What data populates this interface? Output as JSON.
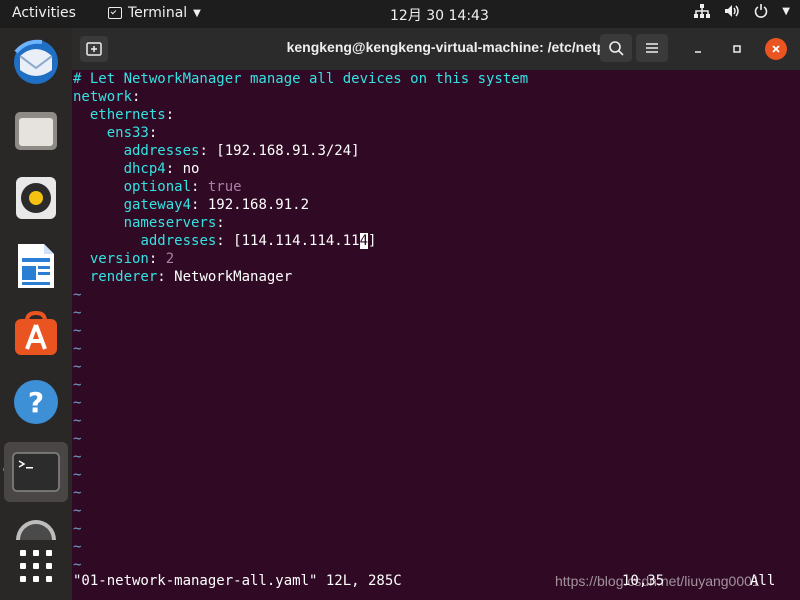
{
  "topbar": {
    "activities": "Activities",
    "app_name": "Terminal",
    "clock": "12月 30  14:43"
  },
  "window": {
    "title": "kengkeng@kengkeng-virtual-machine: /etc/netplan"
  },
  "editor": {
    "comment": "# Let NetworkManager manage all devices on this system",
    "network_key": "network",
    "ethernets_key": "ethernets",
    "ens33_key": "ens33",
    "addresses_key": "addresses",
    "addresses_val": " [192.168.91.3/24]",
    "dhcp4_key": "dhcp4",
    "dhcp4_val": " no",
    "optional_key": "optional",
    "optional_val": "true",
    "gateway4_key": "gateway4",
    "gateway4_val": " 192.168.91.2",
    "nameservers_key": "nameservers",
    "ns_addresses_key": "addresses",
    "ns_addresses_pre": " [114.114.114.11",
    "ns_addresses_cursor": "4",
    "ns_addresses_post": "]",
    "version_key": "version",
    "version_val": "2",
    "renderer_key": "renderer",
    "renderer_val": " NetworkManager",
    "tilde": "~",
    "status_file": "\"01-network-manager-all.yaml\" 12L, 285C",
    "cursor_pos": "10,35",
    "scroll_pos": "All",
    "watermark": "https://blog.csdn.net/liuyang0001"
  },
  "colors": {
    "terminal_bg": "#300a24",
    "accent": "#e95420",
    "cyan": "#34e2e2",
    "magenta": "#ad7fa8",
    "tilde": "#729fcf"
  },
  "dock": {
    "items": [
      "thunderbird-icon",
      "files-icon",
      "rhythmbox-icon",
      "writer-icon",
      "software-icon",
      "help-icon",
      "terminal-icon",
      "dvd-icon",
      "show-apps-icon"
    ]
  }
}
